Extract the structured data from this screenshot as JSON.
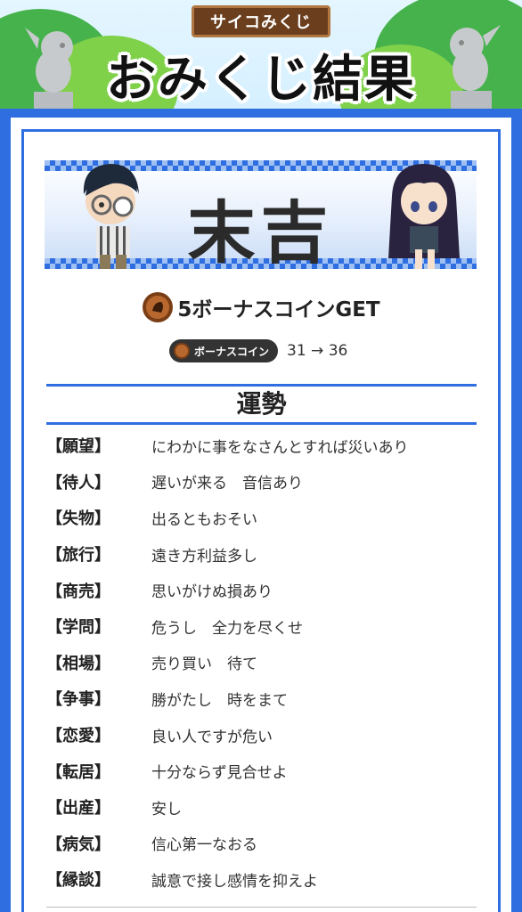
{
  "header": {
    "badge": "サイコみくじ",
    "title": "おみくじ結果"
  },
  "result": {
    "fortune": "末吉",
    "reward_text": "5ボーナスコインGET",
    "coin_label": "ボーナスコイン",
    "coin_change": "31 → 36"
  },
  "section": {
    "title": "運勢",
    "rows": [
      {
        "label": "【願望】",
        "text": "にわかに事をなさんとすれば災いあり"
      },
      {
        "label": "【待人】",
        "text": "遅いが来る　音信あり"
      },
      {
        "label": "【失物】",
        "text": "出るともおそい"
      },
      {
        "label": "【旅行】",
        "text": "遠き方利益多し"
      },
      {
        "label": "【商売】",
        "text": "思いがけぬ損あり"
      },
      {
        "label": "【学問】",
        "text": "危うし　全力を尽くせ"
      },
      {
        "label": "【相場】",
        "text": "売り買い　待て"
      },
      {
        "label": "【争事】",
        "text": "勝がたし　時をまて"
      },
      {
        "label": "【恋愛】",
        "text": "良い人ですが危い"
      },
      {
        "label": "【転居】",
        "text": "十分ならず見合せよ"
      },
      {
        "label": "【出産】",
        "text": "安し"
      },
      {
        "label": "【病気】",
        "text": "信心第一なおる"
      },
      {
        "label": "【縁談】",
        "text": "誠意で接し感情を抑えよ"
      }
    ]
  },
  "colors": {
    "accent": "#2f6ee0",
    "badge_bg": "#6b3e1e",
    "coin": "#8b4a1f"
  }
}
